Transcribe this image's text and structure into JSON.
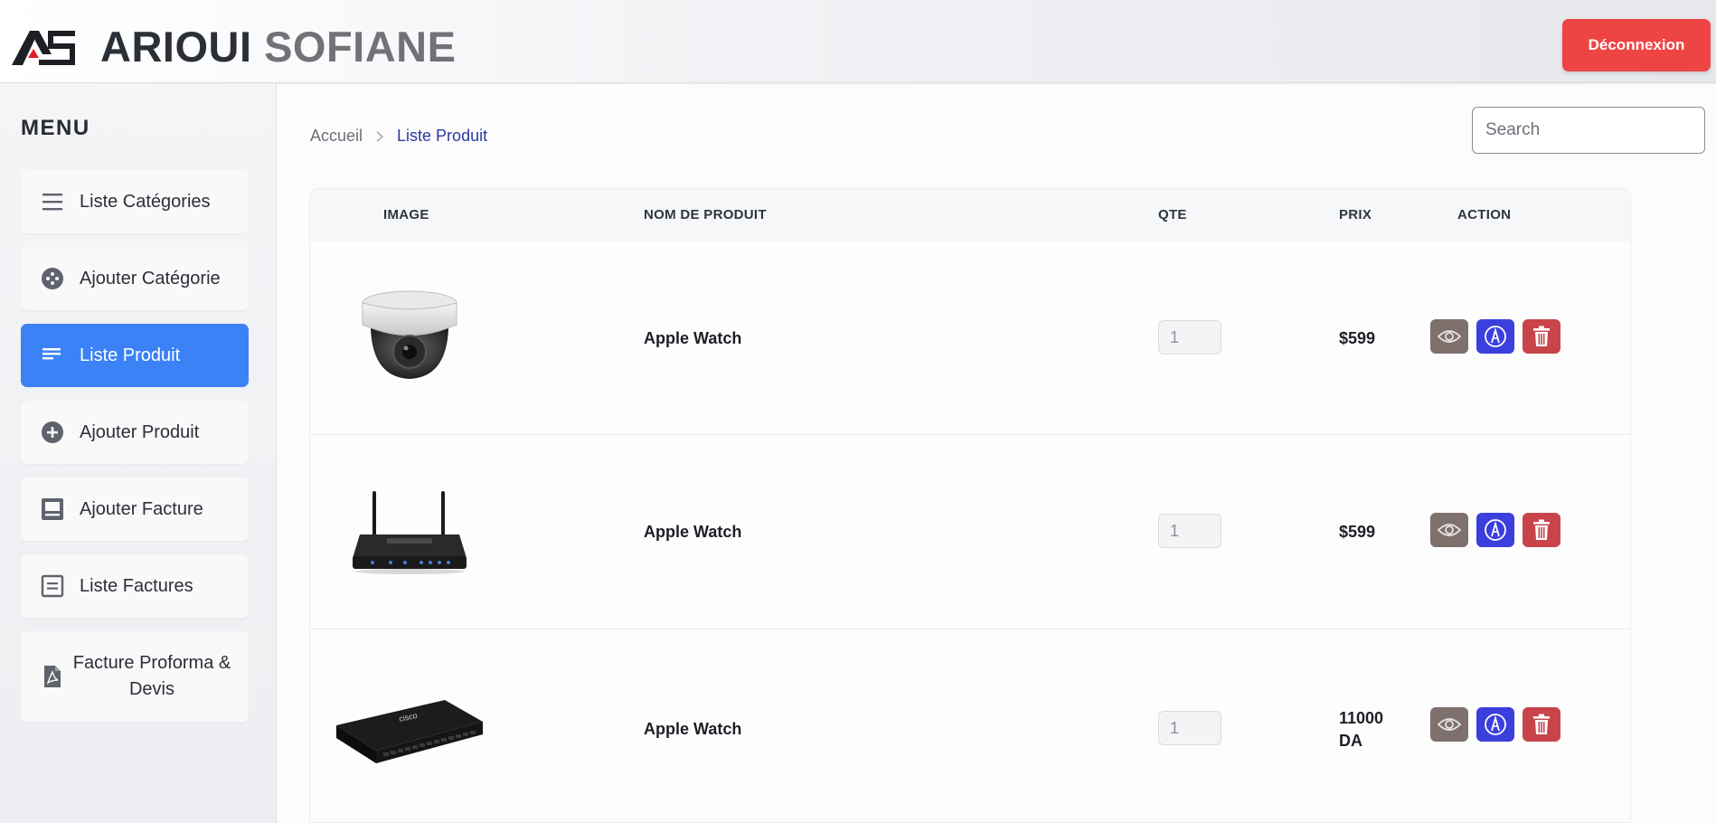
{
  "header": {
    "logo_text": "AS",
    "brand_first": "ARIOUI",
    "brand_second": "SOFIANE",
    "logout_label": "Déconnexion"
  },
  "sidebar": {
    "title": "MENU",
    "items": [
      {
        "label": "Liste Catégories",
        "icon": "list-lines-icon"
      },
      {
        "label": "Ajouter Catégorie",
        "icon": "category-icon"
      },
      {
        "label": "Liste Produit",
        "icon": "list-icon",
        "active": true
      },
      {
        "label": "Ajouter Produit",
        "icon": "plus-circle-icon"
      },
      {
        "label": "Ajouter Facture",
        "icon": "invoice-icon"
      },
      {
        "label": "Liste Factures",
        "icon": "invoice-list-icon"
      },
      {
        "label": "Facture Proforma & Devis",
        "icon": "pdf-file-icon"
      }
    ]
  },
  "breadcrumb": {
    "home": "Accueil",
    "current": "Liste Produit"
  },
  "search": {
    "placeholder": "Search"
  },
  "table": {
    "columns": [
      "IMAGE",
      "NOM DE PRODUIT",
      "QTE",
      "PRIX",
      "ACTION"
    ],
    "rows": [
      {
        "image": "dome-camera",
        "name": "Apple Watch",
        "qty": "1",
        "price": "$599"
      },
      {
        "image": "wifi-router",
        "name": "Apple Watch",
        "qty": "1",
        "price": "$599"
      },
      {
        "image": "network-switch",
        "name": "Apple Watch",
        "qty": "1",
        "price": "11000 DA"
      }
    ]
  },
  "colors": {
    "accent": "#3b82f6",
    "logout": "#ef4444",
    "view_button": "#7e706c",
    "edit_button": "#3b3fdc",
    "delete_button": "#c8444a"
  }
}
